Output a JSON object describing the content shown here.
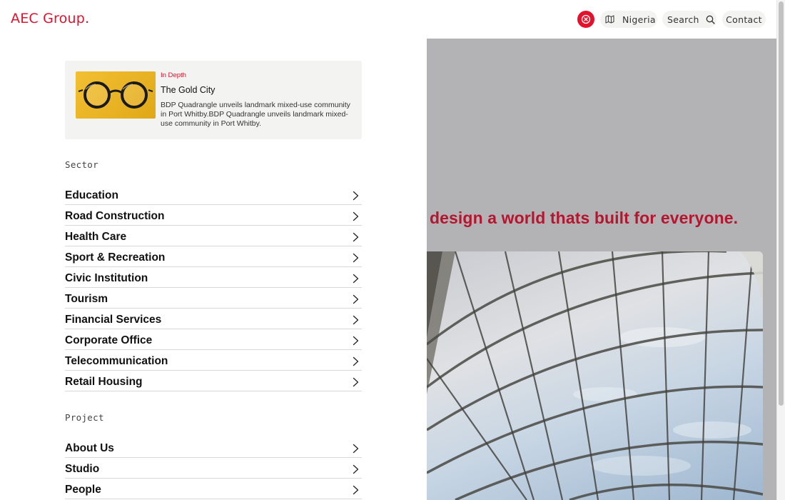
{
  "header": {
    "logo": "AEC Group.",
    "country": "Nigeria",
    "search_label": "Search",
    "contact_label": "Contact"
  },
  "feature": {
    "tag": "In Depth",
    "title": "The Gold City",
    "description": "BDP Quadrangle unveils landmark mixed-use community in Port Whitby.BDP Quadrangle unveils landmark mixed-use community in Port Whitby."
  },
  "sector": {
    "label": "Sector",
    "items": [
      {
        "label": "Education"
      },
      {
        "label": "Road Construction"
      },
      {
        "label": "Health Care"
      },
      {
        "label": "Sport & Recreation"
      },
      {
        "label": "Civic Institution"
      },
      {
        "label": "Tourism"
      },
      {
        "label": "Financial Services"
      },
      {
        "label": "Corporate Office"
      },
      {
        "label": "Telecommunication"
      },
      {
        "label": "Retail Housing"
      }
    ]
  },
  "project": {
    "label": "Project",
    "items": [
      {
        "label": "About Us"
      },
      {
        "label": "Studio"
      },
      {
        "label": "People"
      }
    ]
  },
  "hero": {
    "tagline": "design a world thats built for everyone."
  },
  "colors": {
    "brand_red": "#e3112b",
    "tagline_red": "#b5162f",
    "panel_gray": "#b3b2b5"
  }
}
